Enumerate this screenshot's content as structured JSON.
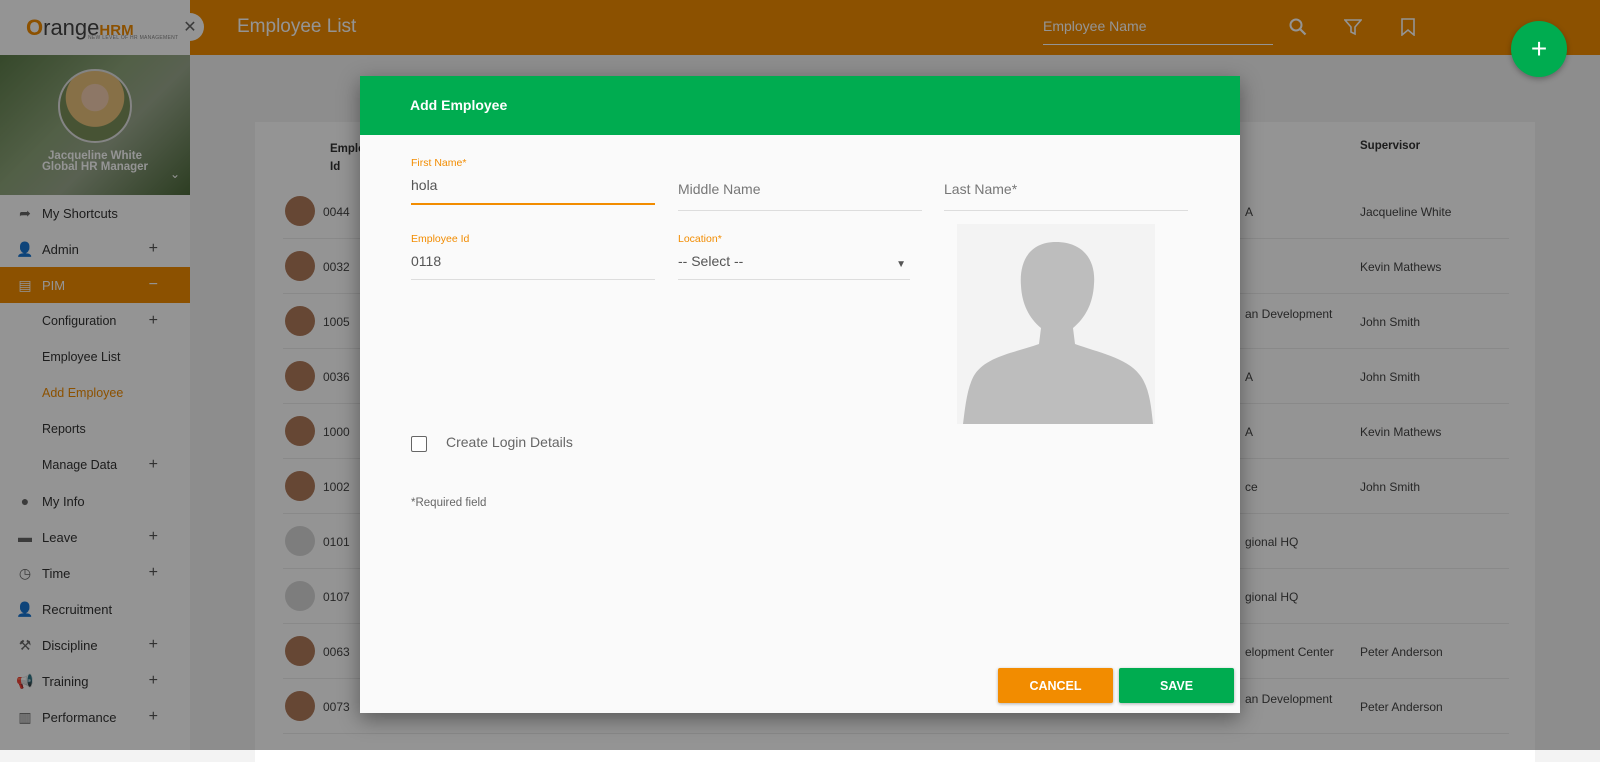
{
  "brand": {
    "logo_o": "O",
    "logo_range": "range",
    "logo_hrm": "HRM",
    "tagline": "NEW LEVEL OF HR MANAGEMENT"
  },
  "user": {
    "name": "Jacqueline White",
    "role": "Global HR Manager"
  },
  "sidebar": {
    "items": [
      {
        "label": "My Shortcuts",
        "icon": "share-arrow-icon"
      },
      {
        "label": "Admin",
        "icon": "user-gear-icon",
        "expand": "+"
      },
      {
        "label": "PIM",
        "icon": "id-card-icon",
        "expand": "−",
        "active": true
      },
      {
        "label": "Configuration",
        "expand": "+"
      },
      {
        "label": "Employee List"
      },
      {
        "label": "Add Employee",
        "current": true
      },
      {
        "label": "Reports"
      },
      {
        "label": "Manage Data",
        "expand": "+"
      },
      {
        "label": "My Info",
        "icon": "user-circle-icon"
      },
      {
        "label": "Leave",
        "icon": "briefcase-icon",
        "expand": "+"
      },
      {
        "label": "Time",
        "icon": "clock-icon",
        "expand": "+"
      },
      {
        "label": "Recruitment",
        "icon": "user-check-icon"
      },
      {
        "label": "Discipline",
        "icon": "gavel-icon",
        "expand": "+"
      },
      {
        "label": "Training",
        "icon": "megaphone-icon",
        "expand": "+"
      },
      {
        "label": "Performance",
        "icon": "bar-chart-icon",
        "expand": "+"
      }
    ]
  },
  "header": {
    "title": "Employee List",
    "search_placeholder": "Employee Name",
    "fab": "+"
  },
  "table": {
    "headers": {
      "id": "Employee Id",
      "supervisor": "Supervisor"
    },
    "rows": [
      {
        "id": "0044",
        "right": "A",
        "supervisor": "Jacqueline White"
      },
      {
        "id": "0032",
        "right": "",
        "supervisor": "Kevin Mathews"
      },
      {
        "id": "1005",
        "right": "an Development",
        "supervisor": "John Smith"
      },
      {
        "id": "0036",
        "right": "A",
        "supervisor": "John Smith"
      },
      {
        "id": "1000",
        "right": "A",
        "supervisor": "Kevin Mathews"
      },
      {
        "id": "1002",
        "right": "ce",
        "supervisor": "John Smith"
      },
      {
        "id": "0101",
        "right": "gional HQ",
        "supervisor": ""
      },
      {
        "id": "0107",
        "right": "gional HQ",
        "supervisor": ""
      },
      {
        "id": "0063",
        "right": "elopment Center",
        "supervisor": "Peter Anderson"
      },
      {
        "id": "0073",
        "right": "an Development",
        "supervisor": "Peter Anderson"
      }
    ]
  },
  "modal": {
    "title": "Add Employee",
    "first_name": {
      "label": "First Name*",
      "value": "hola"
    },
    "middle_name": {
      "placeholder": "Middle Name"
    },
    "last_name": {
      "placeholder": "Last Name*"
    },
    "employee_id": {
      "label": "Employee Id",
      "value": "0118"
    },
    "location": {
      "label": "Location*",
      "value": "-- Select --"
    },
    "create_login": "Create Login Details",
    "required_note": "*Required field",
    "cancel": "CANCEL",
    "save": "SAVE"
  },
  "colors": {
    "orange": "#f28c00",
    "green": "#00ac50"
  }
}
